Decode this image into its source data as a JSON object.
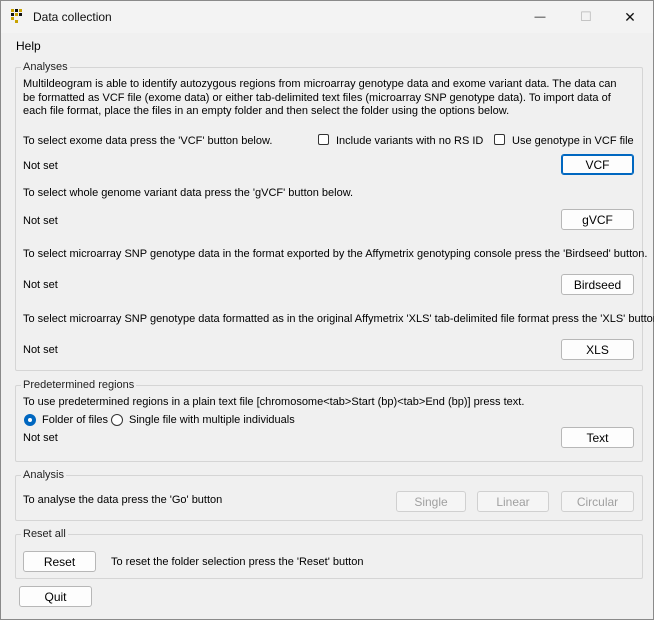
{
  "window": {
    "title": "Data collection",
    "minimize_glyph": "—",
    "maximize_glyph": "☐",
    "close_glyph": "✕"
  },
  "menu": {
    "help": "Help"
  },
  "analyses": {
    "title": "Analyses",
    "description": "Multildeogram is able to identify autozygous regions from microarray genotype data and exome variant data. The data can be formatted as VCF file (exome data) or either tab-delimited text files (microarray SNP genotype data). To import data of each file format, place the files in an empty folder and then select the folder using the options below.",
    "vcf": {
      "instruction": "To select exome data press the 'VCF' button below.",
      "option_no_rsid": "Include variants with no RS ID",
      "option_genotype": "Use genotype in VCF file",
      "status": "Not set",
      "button": "VCF"
    },
    "gvcf": {
      "instruction": "To select whole genome variant data press the 'gVCF' button below.",
      "status": "Not set",
      "button": "gVCF"
    },
    "birdseed": {
      "instruction": "To select microarray SNP genotype data in the format exported by the Affymetrix genotyping console press the 'Birdseed' button.",
      "status": "Not set",
      "button": "Birdseed"
    },
    "xls": {
      "instruction": "To select microarray SNP genotype data formatted as in the original Affymetrix 'XLS' tab-delimited file format press the 'XLS' button.",
      "status": "Not set",
      "button": "XLS"
    }
  },
  "predetermined": {
    "title": "Predetermined regions",
    "instruction": "To use predetermined regions in a plain text file [chromosome<tab>Start (bp)<tab>End (bp)] press text.",
    "option_folder": "Folder of files",
    "option_single": "Single file with multiple individuals",
    "status": "Not set",
    "button": "Text"
  },
  "analysis": {
    "title": "Analysis",
    "instruction": "To analyse the data press the 'Go' button",
    "btn_single": "Single",
    "btn_linear": "Linear",
    "btn_circular": "Circular"
  },
  "reset": {
    "title": "Reset all",
    "button": "Reset",
    "instruction": "To reset the folder selection press the 'Reset' button"
  },
  "quit": "Quit"
}
